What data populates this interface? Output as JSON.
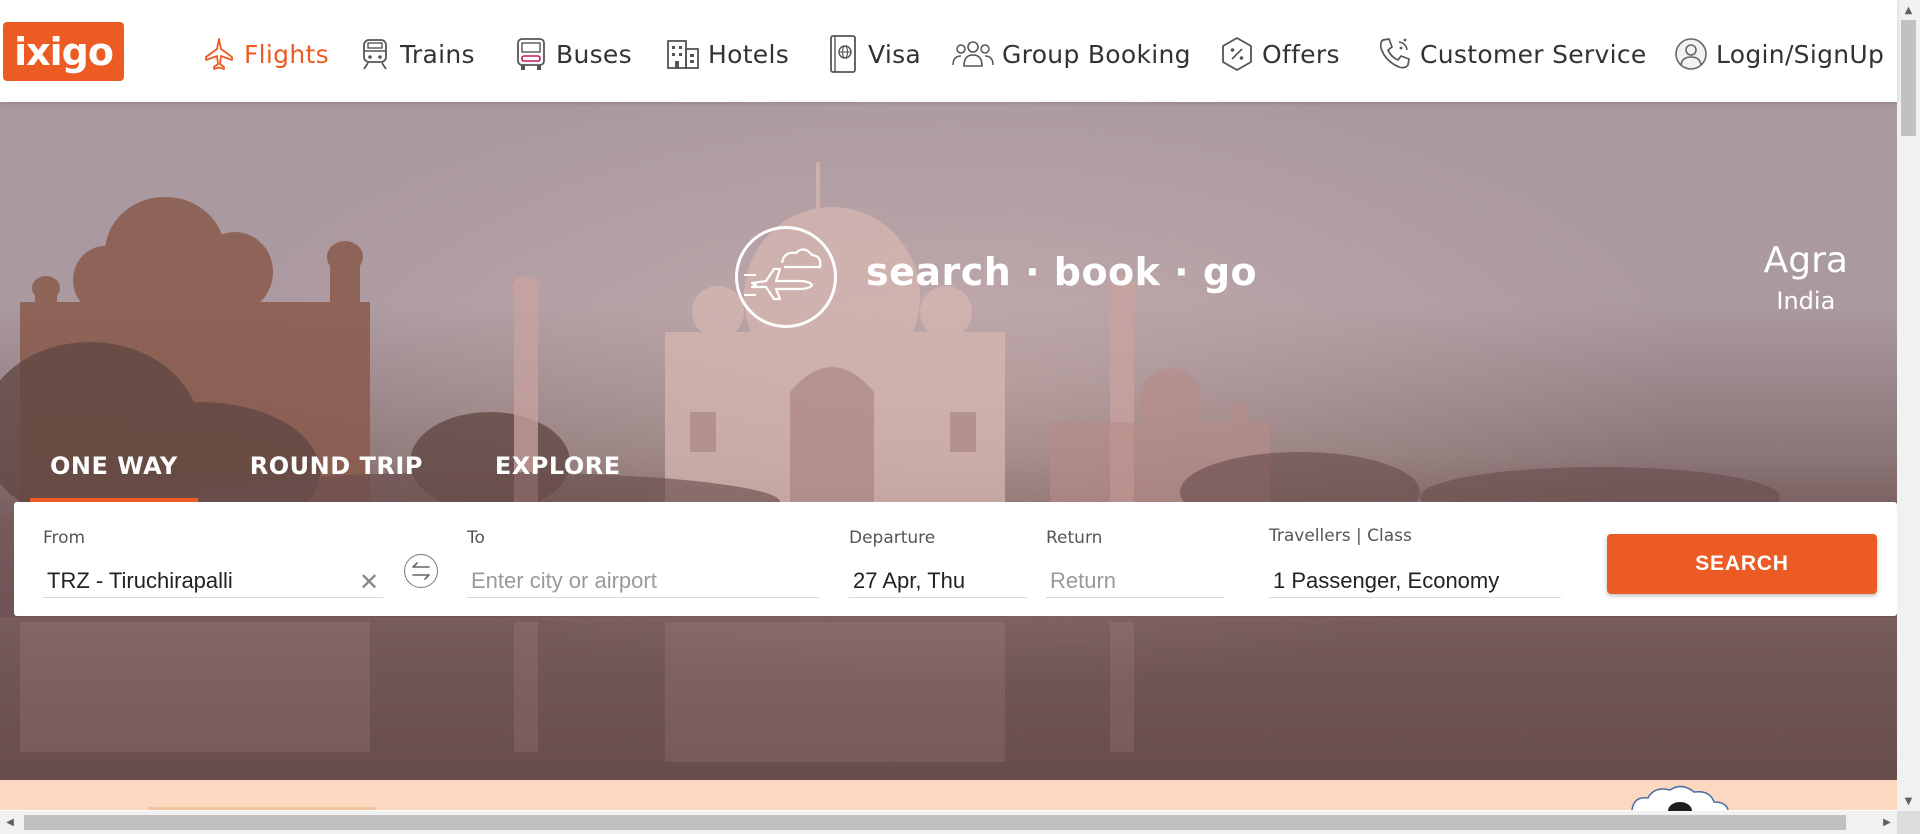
{
  "brand": {
    "logo_text": "ixigo",
    "accent_color": "#ec5b24"
  },
  "nav": {
    "items": [
      {
        "label": "Flights",
        "icon": "plane-icon",
        "active": true
      },
      {
        "label": "Trains",
        "icon": "train-icon"
      },
      {
        "label": "Buses",
        "icon": "bus-icon"
      },
      {
        "label": "Hotels",
        "icon": "hotel-icon"
      },
      {
        "label": "Visa",
        "icon": "passport-icon"
      },
      {
        "label": "Group Booking",
        "icon": "group-icon"
      },
      {
        "label": "Offers",
        "icon": "offer-tag-icon"
      },
      {
        "label": "Customer Service",
        "icon": "phone-support-icon"
      },
      {
        "label": "Login/SignUp",
        "icon": "user-avatar-icon"
      }
    ]
  },
  "hero": {
    "tagline": "search · book · go",
    "city": "Agra",
    "country": "India"
  },
  "tabs": [
    {
      "label": "ONE WAY",
      "active": true
    },
    {
      "label": "ROUND TRIP"
    },
    {
      "label": "EXPLORE"
    }
  ],
  "search": {
    "from": {
      "label": "From",
      "value": "TRZ - Tiruchirapalli"
    },
    "to": {
      "label": "To",
      "placeholder": "Enter city or airport",
      "value": ""
    },
    "departure": {
      "label": "Departure",
      "value": "27 Apr, Thu"
    },
    "return": {
      "label": "Return",
      "placeholder": "Return",
      "value": ""
    },
    "travellers": {
      "label": "Travellers | Class",
      "value": "1 Passenger, Economy"
    },
    "button_label": "SEARCH"
  }
}
